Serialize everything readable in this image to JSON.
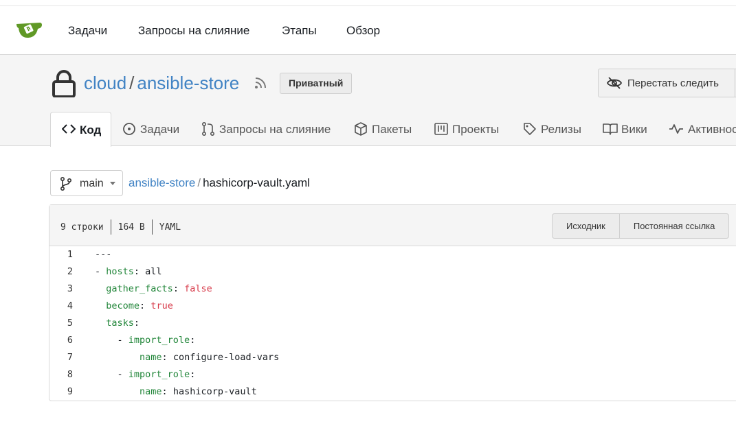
{
  "topnav": {
    "items": [
      "Задачи",
      "Запросы на слияние",
      "Этапы",
      "Обзор"
    ]
  },
  "repo": {
    "owner": "cloud",
    "separator": "/",
    "name": "ansible-store",
    "badge": "Приватный",
    "watch_label": "Перестать следить"
  },
  "tabs": [
    {
      "label": "Код",
      "icon": "code-icon"
    },
    {
      "label": "Задачи",
      "icon": "issue-icon"
    },
    {
      "label": "Запросы на слияние",
      "icon": "pull-request-icon"
    },
    {
      "label": "Пакеты",
      "icon": "package-icon"
    },
    {
      "label": "Проекты",
      "icon": "project-icon"
    },
    {
      "label": "Релизы",
      "icon": "tag-icon"
    },
    {
      "label": "Вики",
      "icon": "book-icon"
    },
    {
      "label": "Активнос",
      "icon": "pulse-icon"
    }
  ],
  "branch": {
    "label": "main"
  },
  "breadcrumb": {
    "repo": "ansible-store",
    "separator": "/",
    "file": "hashicorp-vault.yaml"
  },
  "file": {
    "lines_info": "9 строки",
    "size": "164 B",
    "type": "YAML",
    "raw_label": "Исходник",
    "permalink_label": "Постоянная ссылка"
  },
  "code_lines": [
    {
      "n": "1"
    },
    {
      "n": "2"
    },
    {
      "n": "3"
    },
    {
      "n": "4"
    },
    {
      "n": "5"
    },
    {
      "n": "6"
    },
    {
      "n": "7"
    },
    {
      "n": "8"
    },
    {
      "n": "9"
    }
  ],
  "code_tokens": {
    "l1": "---",
    "l2_dash": "- ",
    "l2_key": "hosts",
    "l2_colon": ": ",
    "l2_val": "all",
    "l3_key": "gather_facts",
    "l3_colon": ": ",
    "l3_val": "false",
    "l4_key": "become",
    "l4_colon": ": ",
    "l4_val": "true",
    "l5_key": "tasks",
    "l5_colon": ":",
    "l6_dash": "- ",
    "l6_key": "import_role",
    "l6_colon": ":",
    "l7_key": "name",
    "l7_colon": ": ",
    "l7_val": "configure-load-vars",
    "l8_dash": "- ",
    "l8_key": "import_role",
    "l8_colon": ":",
    "l9_key": "name",
    "l9_colon": ": ",
    "l9_val": "hashicorp-vault"
  },
  "colors": {
    "link": "#4183c4",
    "yaml_key": "#22863a",
    "yaml_bool": "#d73a49",
    "logo": "#609926"
  }
}
